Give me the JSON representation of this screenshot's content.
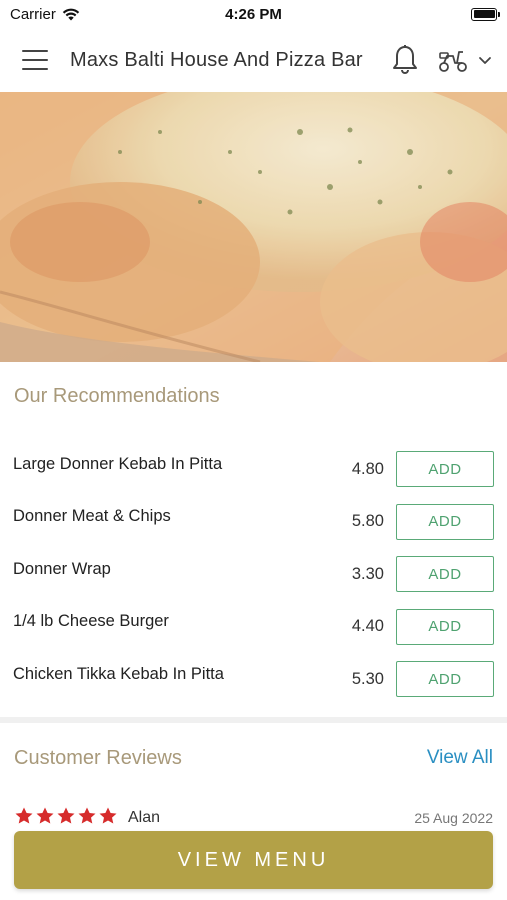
{
  "status_bar": {
    "carrier": "Carrier",
    "time": "4:26 PM"
  },
  "header": {
    "title": "Maxs Balti House And Pizza Bar"
  },
  "recommendations": {
    "title": "Our Recommendations",
    "add_label": "ADD",
    "items": [
      {
        "name": "Large Donner Kebab In Pitta",
        "price": "4.80"
      },
      {
        "name": "Donner Meat & Chips",
        "price": "5.80"
      },
      {
        "name": "Donner Wrap",
        "price": "3.30"
      },
      {
        "name": "1/4 lb Cheese Burger",
        "price": "4.40"
      },
      {
        "name": "Chicken Tikka Kebab In Pitta",
        "price": "5.30"
      }
    ]
  },
  "reviews": {
    "title": "Customer Reviews",
    "view_all": "View All",
    "first": {
      "name": "Alan",
      "date": "25 Aug 2022",
      "rating": 5
    }
  },
  "footer": {
    "view_menu": "VIEW MENU"
  },
  "colors": {
    "accent_gold": "#b3a147",
    "section_title": "#a8997a",
    "add_green": "#4fa270",
    "link_blue": "#2a8fc2",
    "star_red": "#d62b2b"
  }
}
